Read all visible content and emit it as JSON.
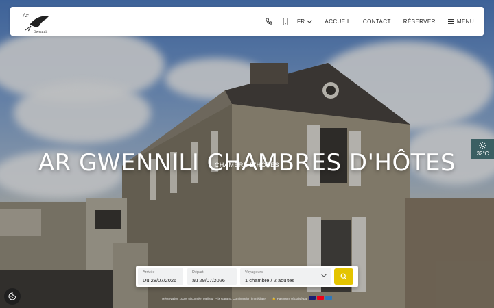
{
  "nav": {
    "logo_text": "Ar Gwennili",
    "language": "FR",
    "links": [
      "ACCUEIL",
      "CONTACT",
      "RÉSERVER"
    ],
    "menu_label": "MENU",
    "icons": [
      "phone-icon",
      "mobile-icon",
      "chevron-down-icon",
      "hamburger-icon"
    ]
  },
  "hero": {
    "title": "AR GWENNILI CHAMBRES D'HÔTES",
    "subtitle": "CHAMBRE D'HÔTES"
  },
  "weather": {
    "temperature": "32°C",
    "icon": "sun-icon"
  },
  "booking": {
    "arrival_label": "Arrivée",
    "arrival_value": "Du 28/07/2026",
    "departure_label": "Départ",
    "departure_value": "au 29/07/2026",
    "guests_label": "Voyageurs",
    "guests_value": "1 chambre / 2 adultes",
    "search_icon": "search-icon"
  },
  "footer": {
    "left_text": "Réservation 100% sécurisée. Meilleur Prix Garanti. Confirmation immédiate",
    "right_text": "Paiement sécurisé par"
  },
  "colors": {
    "accent": "#e4c400",
    "weather_bg": "#3b5f63"
  }
}
